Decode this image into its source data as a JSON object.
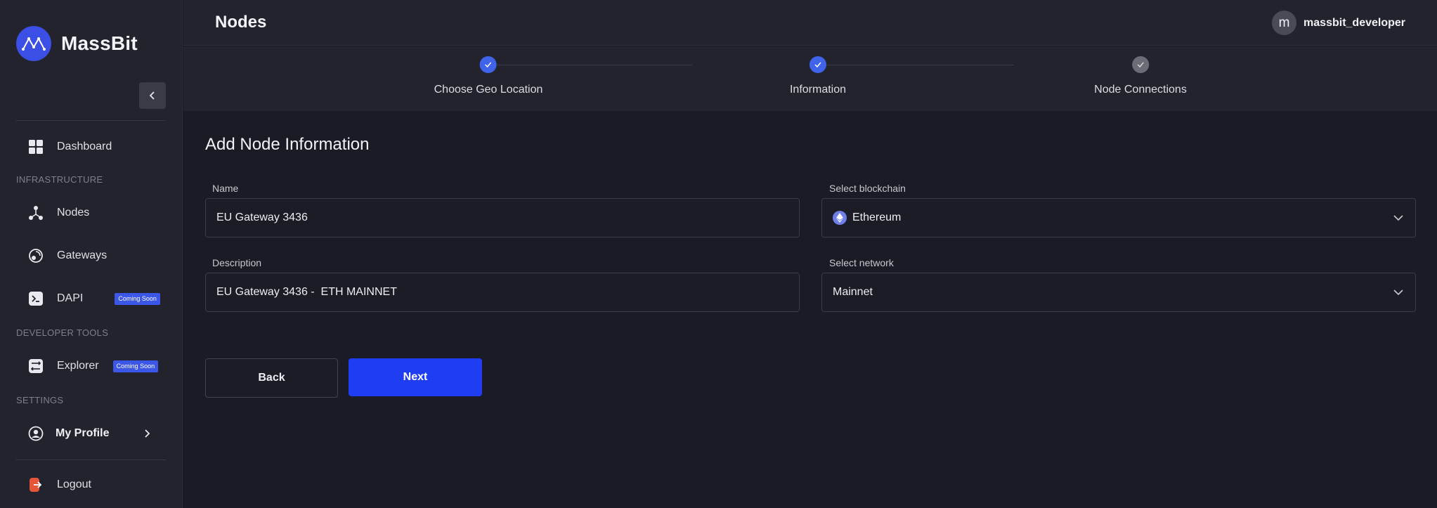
{
  "brand": {
    "name": "MassBit"
  },
  "header": {
    "title": "Nodes",
    "user": {
      "initial": "m",
      "name": "massbit_developer"
    }
  },
  "sidebar": {
    "items": {
      "dashboard": {
        "label": "Dashboard"
      },
      "nodes": {
        "label": "Nodes"
      },
      "gateways": {
        "label": "Gateways"
      },
      "dapi": {
        "label": "DAPI",
        "badge": "Coming Soon"
      },
      "explorer": {
        "label": "Explorer",
        "badge": "Coming Soon"
      },
      "profile": {
        "label": "My Profile"
      },
      "logout": {
        "label": "Logout"
      }
    },
    "sections": {
      "infrastructure": "INFRASTRUCTURE",
      "developer_tools": "DEVELOPER TOOLS",
      "settings": "SETTINGS"
    }
  },
  "stepper": {
    "steps": [
      {
        "label": "Choose Geo Location",
        "status": "done"
      },
      {
        "label": "Information",
        "status": "done"
      },
      {
        "label": "Node Connections",
        "status": "pending"
      }
    ]
  },
  "form": {
    "title": "Add Node Information",
    "name": {
      "label": "Name",
      "value": "EU Gateway 3436"
    },
    "description": {
      "label": "Description",
      "value": "EU Gateway 3436 -  ETH MAINNET"
    },
    "blockchain": {
      "label": "Select blockchain",
      "value": "Ethereum"
    },
    "network": {
      "label": "Select network",
      "value": "Mainnet"
    },
    "back_label": "Back",
    "next_label": "Next"
  },
  "colors": {
    "accent": "#1f3df2",
    "step_done": "#3f63e9",
    "badge": "#3c56e8",
    "logout_icon": "#e4553a",
    "background": "#1a1b24",
    "sidebar": "#22232d"
  }
}
